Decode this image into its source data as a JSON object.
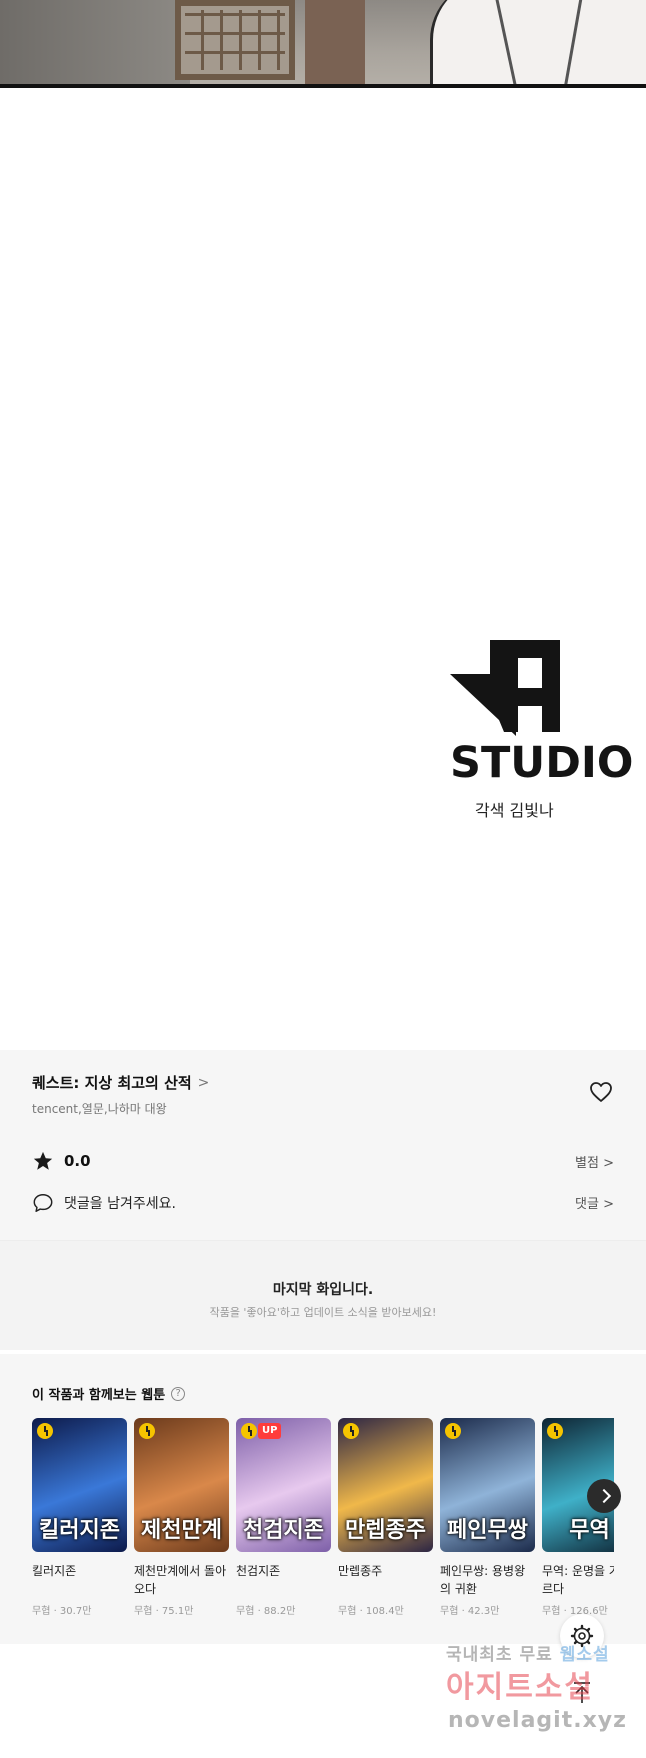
{
  "studio": {
    "logo_text": "STUDIO",
    "credit": "각색 김빛나"
  },
  "series": {
    "title": "퀘스트: 지상 최고의 산적",
    "authors": "tencent,열문,나하마 대왕",
    "rating": "0.0",
    "rate_label": "별점",
    "comment_placeholder": "댓글을 남겨주세요.",
    "comment_label": "댓글"
  },
  "last_episode": {
    "title": "마지막 화입니다.",
    "subtitle": "작품을 '좋아요'하고 업데이트 소식을 받아보세요!"
  },
  "recommendations": {
    "heading": "이 작품과 함께보는 웹툰",
    "items": [
      {
        "title": "킬러지존",
        "meta": "무협 · 30.7만",
        "cover_text": "킬러지존",
        "badge": "clock",
        "colors": [
          "#0d1a4a",
          "#3a78d8"
        ]
      },
      {
        "title": "제천만계에서 돌아오다",
        "meta": "무협 · 75.1만",
        "cover_text": "제천만계",
        "badge": "clock",
        "colors": [
          "#6b3a1c",
          "#d9884a"
        ]
      },
      {
        "title": "천검지존",
        "meta": "무협 · 88.2만",
        "cover_text": "천검지존",
        "badge": "clock-up",
        "badge_text": "UP",
        "colors": [
          "#7d5fa8",
          "#e7c9ee"
        ]
      },
      {
        "title": "만렙종주",
        "meta": "무협 · 108.4만",
        "cover_text": "만렙종주",
        "badge": "clock",
        "colors": [
          "#2c2544",
          "#f0b84a"
        ]
      },
      {
        "title": "페인무쌍: 용병왕의 귀환",
        "meta": "무협 · 42.3만",
        "cover_text": "페인무쌍",
        "badge": "clock",
        "colors": [
          "#1b2a4a",
          "#8fb3d8"
        ]
      },
      {
        "title": "무역: 운명을 거스르다",
        "meta": "무협 · 126.6만",
        "cover_text": "무역",
        "badge": "clock",
        "colors": [
          "#0e2433",
          "#3fb0c8"
        ]
      }
    ]
  },
  "watermark": {
    "line1_a": "국내최초 무료",
    "line1_b": "웹소설",
    "line2": "아지트소설",
    "line3": "novelagit.xyz"
  }
}
